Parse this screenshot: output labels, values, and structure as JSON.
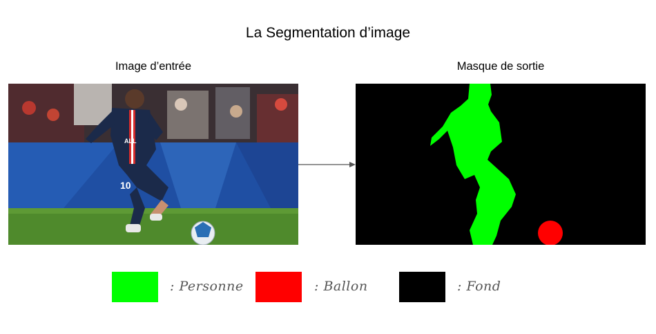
{
  "title": "La Segmentation d’image",
  "input": {
    "caption": "Image d’entrée",
    "jersey_number": "10",
    "sponsor": "ALL"
  },
  "output": {
    "caption": "Masque de sortie"
  },
  "legend": [
    {
      "color": "#00ff00",
      "label": ": Personne"
    },
    {
      "color": "#ff0000",
      "label": ": Ballon"
    },
    {
      "color": "#000000",
      "label": ": Fond"
    }
  ],
  "colors": {
    "person": "#00ff00",
    "ball": "#ff0000",
    "background": "#000000",
    "arrow": "#555555"
  }
}
